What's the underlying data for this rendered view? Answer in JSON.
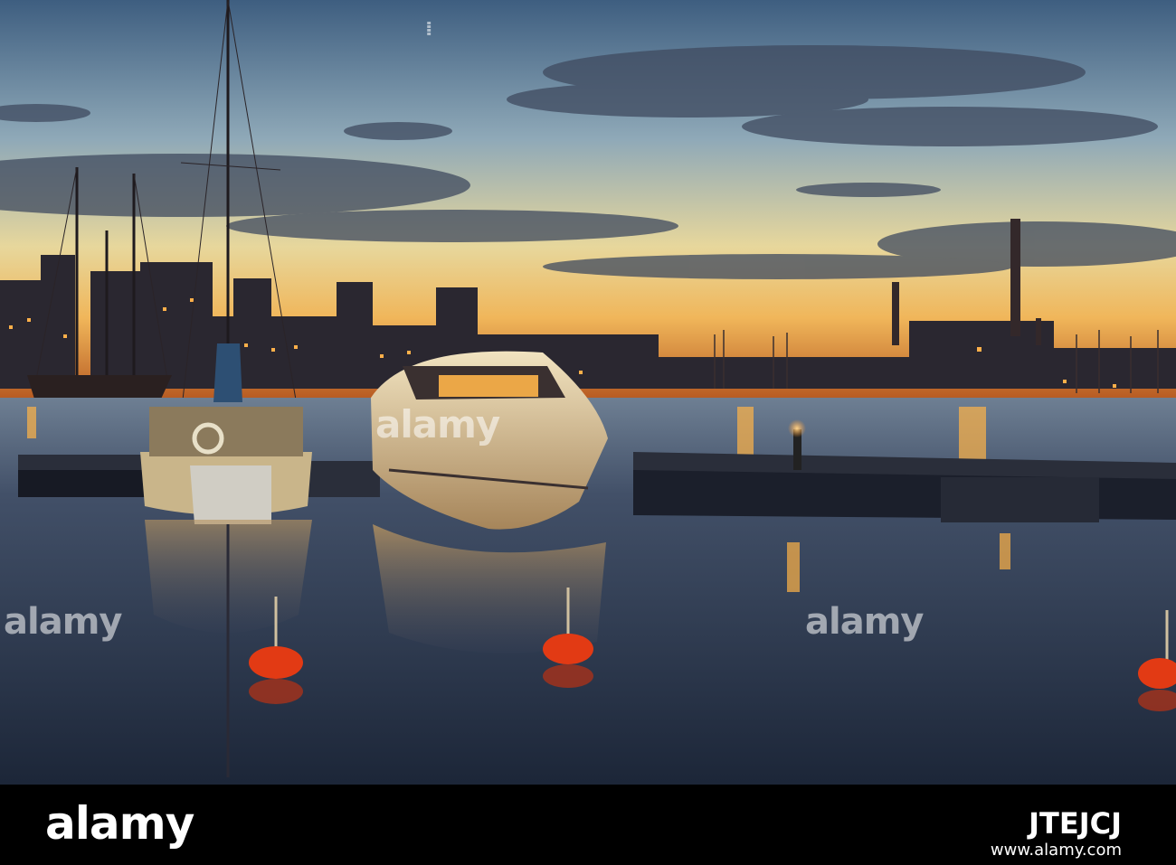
{
  "watermark": {
    "text": "alamy",
    "footer_logo": "alamy",
    "image_id": "JTEJCJ",
    "url": "www.alamy.com"
  },
  "palette": {
    "sky_top": "#4f6f8f",
    "sky_mid": "#a9bcc4",
    "sky_glow": "#f4d98a",
    "horizon": "#e89a3a",
    "water": "#2c3b52",
    "buoy": "#e23a14",
    "light": "#ffb347"
  }
}
